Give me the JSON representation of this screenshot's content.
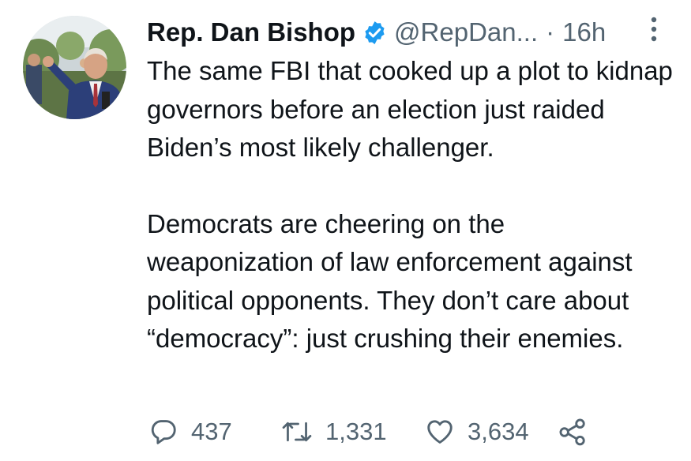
{
  "author": {
    "name": "Rep. Dan Bishop",
    "handle": "@RepDan...",
    "separator": "·",
    "timestamp": "16h",
    "verified": true
  },
  "tweet": {
    "paragraphs": [
      "The same FBI that cooked up a plot to kidnap governors before an election just raided Biden’s most likely challenger.",
      "Democrats are cheering on the weaponization of law enforcement against political opponents. They don’t care about “democracy”: just crushing their enemies."
    ]
  },
  "actions": {
    "replies": "437",
    "retweets": "1,331",
    "likes": "3,634"
  },
  "icons": {
    "reply": "reply-icon",
    "retweet": "retweet-icon",
    "like": "heart-icon",
    "share": "share-icon",
    "more": "more-vertical-icon",
    "verified": "verified-badge-icon"
  },
  "colors": {
    "text": "#0f1419",
    "secondary": "#536471",
    "verified": "#1d9bf0"
  }
}
